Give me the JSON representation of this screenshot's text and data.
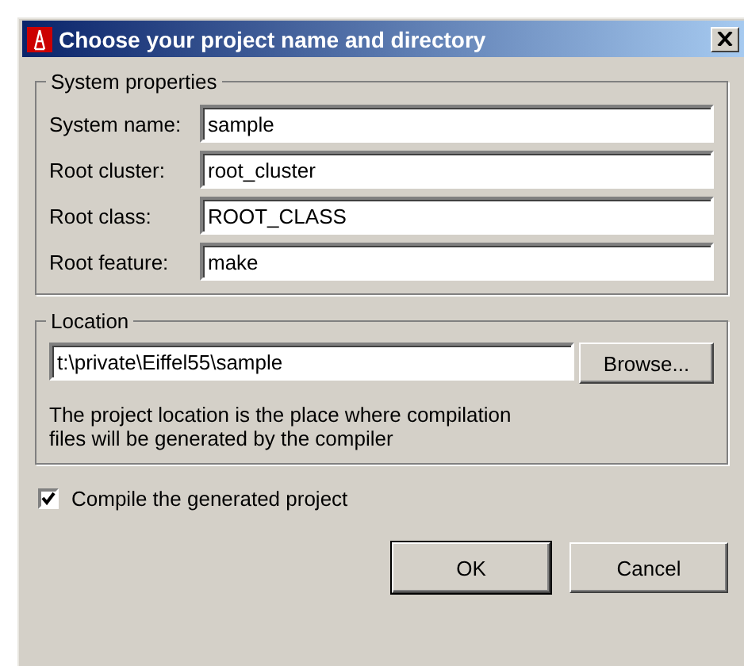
{
  "window": {
    "title": "Choose your project name and directory"
  },
  "system_properties": {
    "title": "System properties",
    "fields": [
      {
        "label": "System name:",
        "value": "sample"
      },
      {
        "label": "Root cluster:",
        "value": "root_cluster"
      },
      {
        "label": "Root class:",
        "value": "ROOT_CLASS"
      },
      {
        "label": "Root feature:",
        "value": "make"
      }
    ]
  },
  "location": {
    "title": "Location",
    "path": "t:\\private\\Eiffel55\\sample",
    "browse_button": "Browse...",
    "note": "The project location is the place where compilation files will be generated by the compiler"
  },
  "compile_checkbox": {
    "label": "Compile the generated project",
    "checked": true
  },
  "buttons": [
    "OK",
    "Cancel"
  ]
}
